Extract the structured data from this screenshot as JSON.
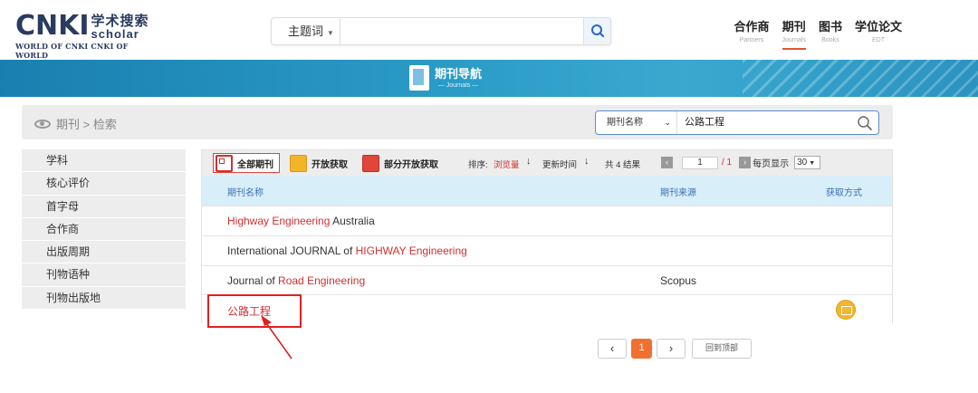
{
  "header": {
    "logo": {
      "main": "CNKI",
      "cn": "学术搜索",
      "scholar": "scholar",
      "sub": "WORLD OF CNKI CNKI OF WORLD"
    },
    "search": {
      "field_label": "主题词",
      "value": ""
    },
    "nav": [
      {
        "cn": "合作商",
        "en": "Partners"
      },
      {
        "cn": "期刊",
        "en": "Journals"
      },
      {
        "cn": "图书",
        "en": "Books"
      },
      {
        "cn": "学位论文",
        "en": "EDT"
      }
    ]
  },
  "banner": {
    "title": "期刊导航",
    "subtitle": "— Journals —"
  },
  "breadcrumb": {
    "text": "期刊 > 检索"
  },
  "inner_search": {
    "field_label": "期刊名称",
    "value": "公路工程"
  },
  "sidebar": {
    "items": [
      "学科",
      "核心评价",
      "首字母",
      "合作商",
      "出版周期",
      "刊物语种",
      "刊物出版地"
    ]
  },
  "toolbar": {
    "all_label": "全部期刊",
    "open_label": "开放获取",
    "partial_label": "部分开放获取",
    "sort_label": "排序:",
    "sort_views": "浏览量",
    "sort_time": "更新时间",
    "total": "共 4 结果",
    "page_value": "1",
    "page_total": "/ 1",
    "per_page_label": "每页显示",
    "per_page_value": "30"
  },
  "table": {
    "headers": {
      "name": "期刊名称",
      "source": "期刊来源",
      "access": "获取方式"
    },
    "rows": [
      {
        "pre": "",
        "hl": "Highway Engineering",
        "post": " Australia",
        "source": "",
        "oa": false
      },
      {
        "pre": "International JOURNAL of ",
        "hl": "HIGHWAY Engineering",
        "post": "",
        "source": "",
        "oa": false
      },
      {
        "pre": "Journal of ",
        "hl": "Road Engineering",
        "post": "",
        "source": "Scopus",
        "oa": false
      },
      {
        "pre": "",
        "hl": "公路工程",
        "post": "",
        "source": "",
        "oa": true
      }
    ]
  },
  "pagination": {
    "prev": "‹",
    "current": "1",
    "next": "›",
    "top": "回到顶部"
  },
  "colors": {
    "accent": "#d03030",
    "banner": "#2a9bc6",
    "header_row": "#d8eef9",
    "page_active": "#f07030"
  }
}
